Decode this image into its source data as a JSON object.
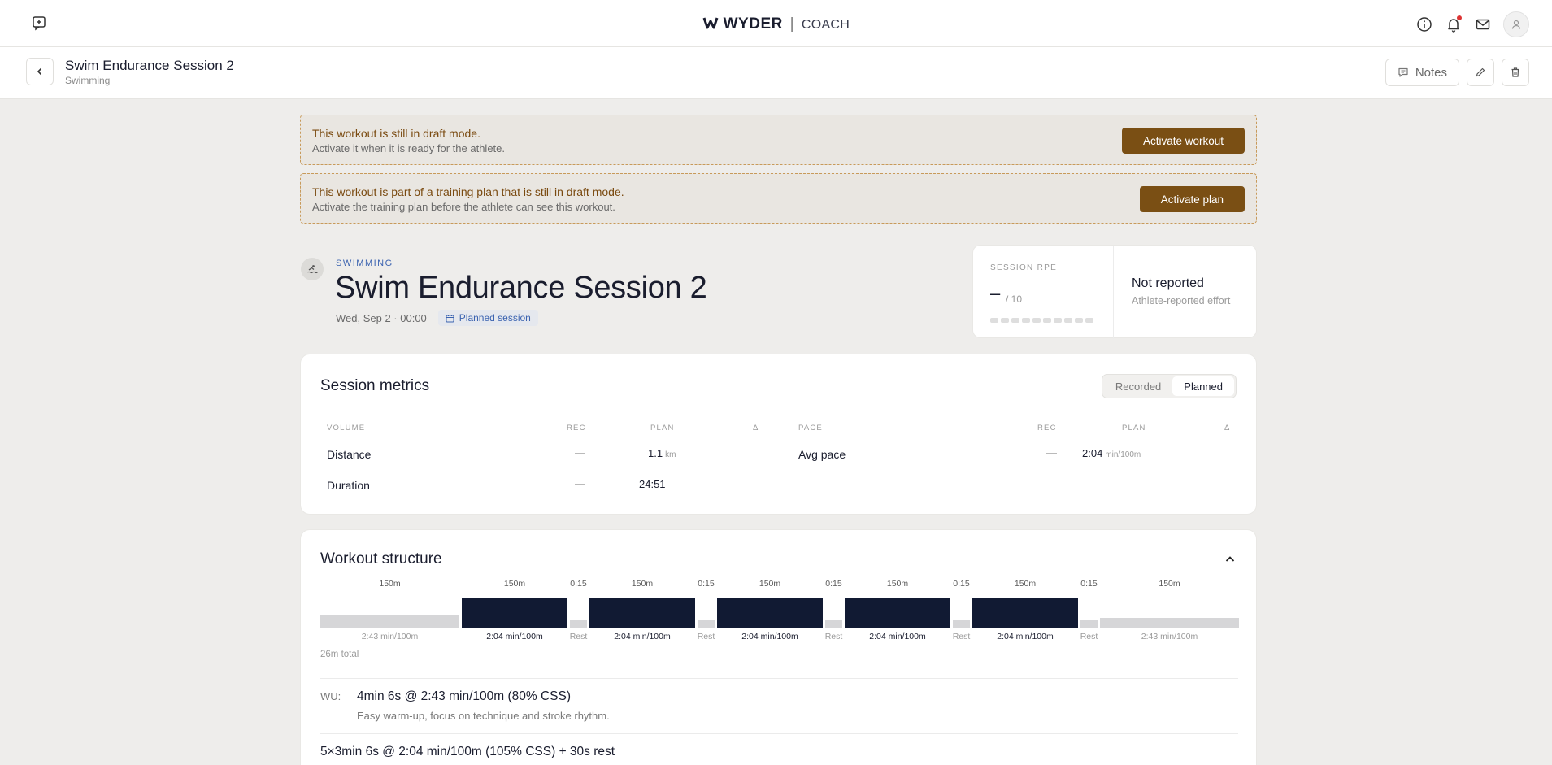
{
  "brand": {
    "name": "WYDER",
    "separator": "|",
    "product": "COACH"
  },
  "header": {
    "title": "Swim Endurance Session 2",
    "subtitle": "Swimming",
    "notes_label": "Notes"
  },
  "banners": [
    {
      "title": "This workout is still in draft mode.",
      "subtitle": "Activate it when it is ready for the athlete.",
      "button": "Activate workout"
    },
    {
      "title": "This workout is part of a training plan that is still in draft mode.",
      "subtitle": "Activate the training plan before the athlete can see this workout.",
      "button": "Activate plan"
    }
  ],
  "session": {
    "sport": "SWIMMING",
    "title": "Swim Endurance Session 2",
    "datetime": "Wed, Sep 2 · 00:00",
    "chip": "Planned session"
  },
  "rpe": {
    "label": "SESSION RPE",
    "value": "–",
    "max": "/ 10",
    "scale_max": 10,
    "status": "Not reported",
    "status_sub": "Athlete-reported effort"
  },
  "metrics": {
    "title": "Session metrics",
    "toggle": [
      "Recorded",
      "Planned"
    ],
    "toggle_active": 1,
    "volume": {
      "headers": [
        "VOLUME",
        "REC",
        "PLAN",
        "Δ"
      ],
      "rows": [
        {
          "name": "Distance",
          "rec": "—",
          "plan": "1.1",
          "unit": "km",
          "delta": "—"
        },
        {
          "name": "Duration",
          "rec": "—",
          "plan": "24:51",
          "unit": "",
          "delta": "—"
        }
      ]
    },
    "pace": {
      "headers": [
        "PACE",
        "REC",
        "PLAN",
        "Δ"
      ],
      "rows": [
        {
          "name": "Avg pace",
          "rec": "—",
          "plan": "2:04",
          "unit": "min/100m",
          "delta": "—"
        }
      ]
    }
  },
  "structure": {
    "title": "Workout structure",
    "segments": [
      {
        "kind": "warm",
        "top": "150m",
        "bottom": "2:43 min/100m"
      },
      {
        "kind": "work",
        "top": "150m",
        "bottom": "2:04 min/100m"
      },
      {
        "kind": "rest",
        "top": "0:15",
        "bottom": "Rest"
      },
      {
        "kind": "work",
        "top": "150m",
        "bottom": "2:04 min/100m"
      },
      {
        "kind": "rest",
        "top": "0:15",
        "bottom": "Rest"
      },
      {
        "kind": "work",
        "top": "150m",
        "bottom": "2:04 min/100m"
      },
      {
        "kind": "rest",
        "top": "0:15",
        "bottom": "Rest"
      },
      {
        "kind": "work",
        "top": "150m",
        "bottom": "2:04 min/100m"
      },
      {
        "kind": "rest",
        "top": "0:15",
        "bottom": "Rest"
      },
      {
        "kind": "work",
        "top": "150m",
        "bottom": "2:04 min/100m"
      },
      {
        "kind": "rest",
        "top": "0:15",
        "bottom": "Rest"
      },
      {
        "kind": "cool",
        "top": "150m",
        "bottom": "2:43 min/100m"
      }
    ],
    "total": "26m total",
    "steps": [
      {
        "label": "WU:",
        "title": "4min 6s @ 2:43 min/100m (80% CSS)",
        "sub": "Easy warm-up, focus on technique and stroke rhythm."
      },
      {
        "label": "",
        "title": "5×3min 6s @ 2:04 min/100m (105% CSS) + 30s rest",
        "sub": ""
      }
    ]
  },
  "colors": {
    "accent": "#7a4f14",
    "work_bar": "#111a33",
    "light_bar": "#d6d6d8",
    "link": "#3b63b0"
  },
  "icons": {
    "left": "feedback-icon",
    "info": "info-icon",
    "bell": "bell-icon",
    "mail": "mail-icon",
    "user": "user-icon",
    "back": "chevron-left-icon",
    "notes": "message-icon",
    "edit": "pencil-icon",
    "delete": "trash-icon",
    "sport": "swimmer-icon",
    "calendar": "calendar-icon",
    "collapse": "chevron-up-icon"
  }
}
